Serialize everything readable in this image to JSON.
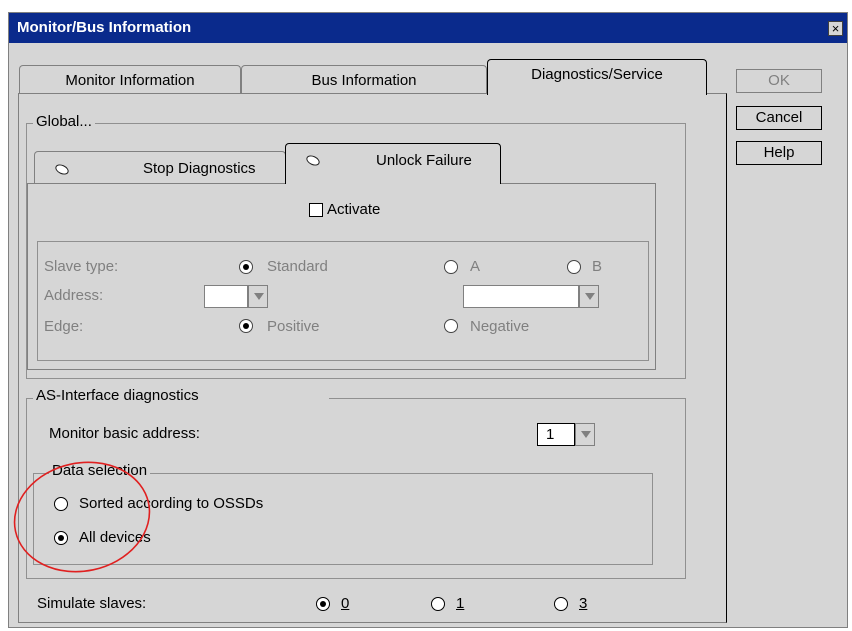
{
  "window": {
    "title": "Monitor/Bus Information",
    "close_glyph": "×"
  },
  "tabs": [
    {
      "label": "Monitor Information",
      "active": false
    },
    {
      "label": "Bus Information",
      "active": false
    },
    {
      "label": "Diagnostics/Service",
      "active": true
    }
  ],
  "buttons": {
    "ok": "OK",
    "cancel": "Cancel",
    "help": "Help"
  },
  "global": {
    "label": "Global...",
    "subtabs": [
      {
        "label": "Stop Diagnostics",
        "active": false
      },
      {
        "label": "Unlock Failure",
        "active": true
      }
    ],
    "activate_label": "Activate",
    "activate_checked": false,
    "slave_type_label": "Slave type:",
    "slave_type_options": [
      "Standard",
      "A",
      "B"
    ],
    "slave_type_selected": "Standard",
    "address_label": "Address:",
    "address_value": "",
    "address_value_2": "",
    "edge_label": "Edge:",
    "edge_options": [
      "Positive",
      "Negative"
    ],
    "edge_selected": "Positive"
  },
  "diagnostics": {
    "label": "AS-Interface diagnostics",
    "monitor_address_label": "Monitor basic address:",
    "monitor_address_value": "1",
    "data_selection": {
      "label": "Data selection",
      "options": [
        "Sorted according to OSSDs",
        "All devices"
      ],
      "selected": "All devices"
    }
  },
  "simulate": {
    "label": "Simulate slaves:",
    "options": [
      "0",
      "1",
      "3"
    ],
    "selected": "0"
  },
  "annotation": {
    "color": "#e02020"
  }
}
